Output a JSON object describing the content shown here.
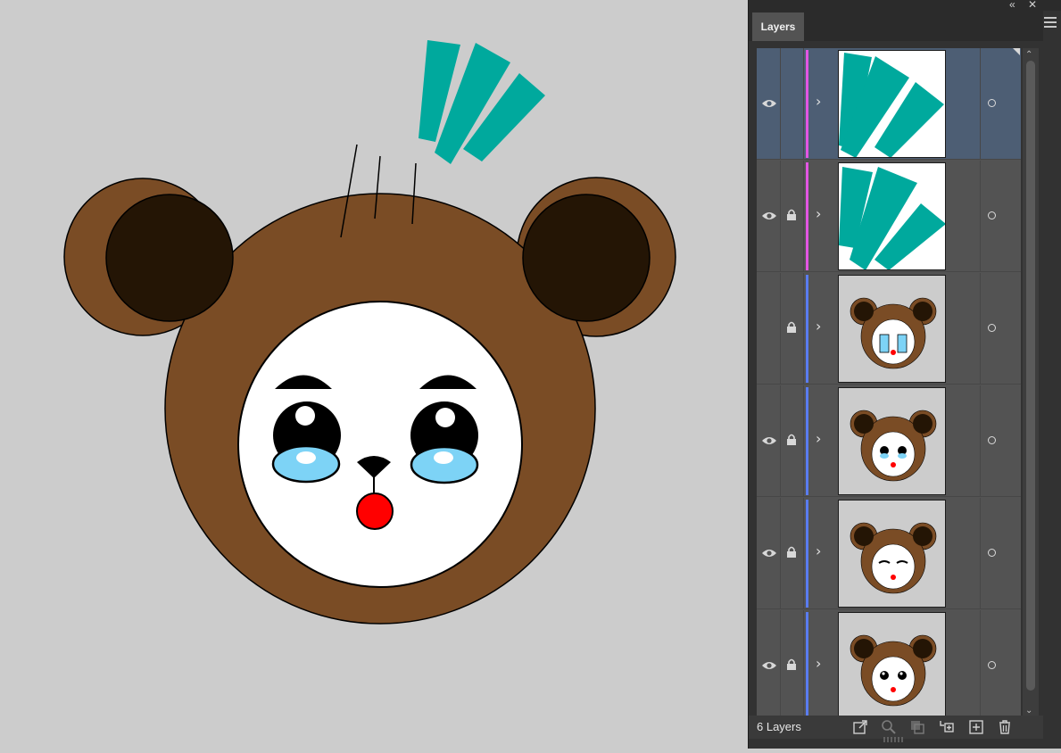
{
  "panel": {
    "tab_label": "Layers",
    "footer_label": "6 Layers",
    "collapse_icon": "double-chevron-icon",
    "close_icon": "close-icon",
    "menu_icon": "hamburger-menu-icon"
  },
  "colors": {
    "accent_magenta": "#e356e3",
    "accent_blue": "#5a7cf0",
    "teal": "#00a99d",
    "bear_brown": "#7a4c25",
    "ear_dark": "#241505",
    "tear_blue": "#7dd3f6",
    "nose_red": "#ff0000"
  },
  "layers": [
    {
      "visible": true,
      "locked": false,
      "color": "magenta",
      "thumbnail": "teal-lines",
      "selected": true
    },
    {
      "visible": true,
      "locked": true,
      "color": "magenta",
      "thumbnail": "teal-lines",
      "selected": false
    },
    {
      "visible": false,
      "locked": true,
      "color": "blue",
      "thumbnail": "bear-crying-big-tears",
      "selected": false
    },
    {
      "visible": true,
      "locked": true,
      "color": "blue",
      "thumbnail": "bear-teary",
      "selected": false
    },
    {
      "visible": true,
      "locked": true,
      "color": "blue",
      "thumbnail": "bear-sleepy",
      "selected": false
    },
    {
      "visible": true,
      "locked": true,
      "color": "blue",
      "thumbnail": "bear-happy",
      "selected": false
    }
  ],
  "footer_icons": [
    "export-icon",
    "search-icon",
    "clipping-mask-icon",
    "sublayer-icon",
    "new-layer-icon",
    "trash-icon"
  ]
}
